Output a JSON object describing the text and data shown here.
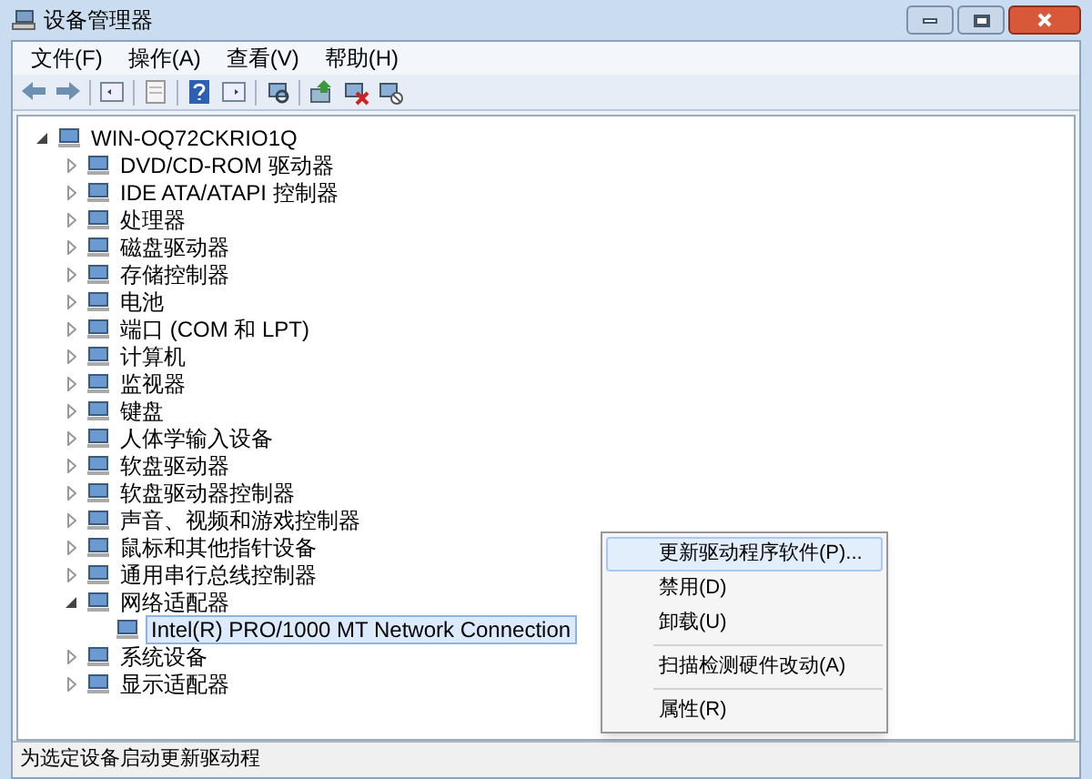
{
  "window": {
    "title": "设备管理器"
  },
  "menu": [
    "文件(F)",
    "操作(A)",
    "查看(V)",
    "帮助(H)"
  ],
  "toolbar": [
    [
      {
        "kind": "back"
      },
      {
        "kind": "forward"
      }
    ],
    [
      {
        "kind": "panel"
      }
    ],
    [
      {
        "kind": "doc"
      }
    ],
    [
      {
        "kind": "help"
      },
      {
        "kind": "panel2"
      }
    ],
    [
      {
        "kind": "scan"
      }
    ],
    [
      {
        "kind": "update"
      },
      {
        "kind": "remove"
      },
      {
        "kind": "disable"
      }
    ]
  ],
  "tree": {
    "label": "WIN-OQ72CKRIO1Q",
    "expanded": true,
    "children": [
      {
        "label": "DVD/CD-ROM 驱动器",
        "expanded": false
      },
      {
        "label": "IDE ATA/ATAPI 控制器",
        "expanded": false
      },
      {
        "label": "处理器",
        "expanded": false
      },
      {
        "label": "磁盘驱动器",
        "expanded": false
      },
      {
        "label": "存储控制器",
        "expanded": false
      },
      {
        "label": "电池",
        "expanded": false
      },
      {
        "label": "端口 (COM 和 LPT)",
        "expanded": false
      },
      {
        "label": "计算机",
        "expanded": false
      },
      {
        "label": "监视器",
        "expanded": false
      },
      {
        "label": "键盘",
        "expanded": false
      },
      {
        "label": "人体学输入设备",
        "expanded": false
      },
      {
        "label": "软盘驱动器",
        "expanded": false
      },
      {
        "label": "软盘驱动器控制器",
        "expanded": false
      },
      {
        "label": "声音、视频和游戏控制器",
        "expanded": false
      },
      {
        "label": "鼠标和其他指针设备",
        "expanded": false
      },
      {
        "label": "通用串行总线控制器",
        "expanded": false
      },
      {
        "label": "网络适配器",
        "expanded": true,
        "children": [
          {
            "label": "Intel(R) PRO/1000 MT Network Connection",
            "selected": true
          }
        ]
      },
      {
        "label": "系统设备",
        "expanded": false
      },
      {
        "label": "显示适配器",
        "expanded": false
      }
    ]
  },
  "context_menu": [
    [
      {
        "label": "更新驱动程序软件(P)...",
        "selected": true
      },
      {
        "label": "禁用(D)",
        "selected": false
      },
      {
        "label": "卸载(U)",
        "selected": false
      }
    ],
    [
      {
        "label": "扫描检测硬件改动(A)",
        "selected": false
      }
    ],
    [
      {
        "label": "属性(R)",
        "selected": false
      }
    ]
  ],
  "status_bar": "为选定设备启动更新驱动程"
}
